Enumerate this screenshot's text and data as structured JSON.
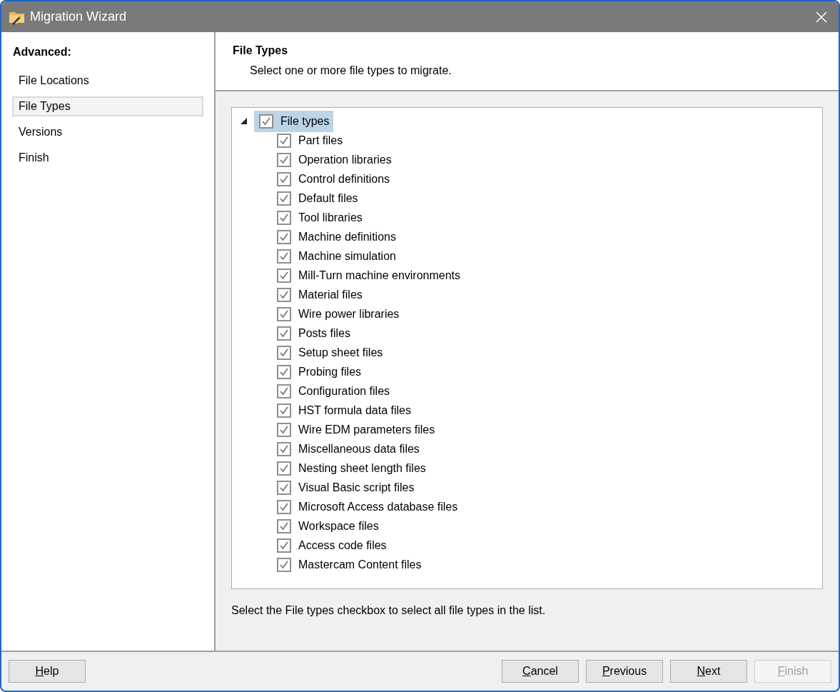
{
  "window": {
    "title": "Migration Wizard"
  },
  "sidebar": {
    "heading": "Advanced:",
    "items": [
      {
        "label": "File Locations",
        "selected": false
      },
      {
        "label": "File Types",
        "selected": true
      },
      {
        "label": "Versions",
        "selected": false
      },
      {
        "label": "Finish",
        "selected": false
      }
    ]
  },
  "header": {
    "title": "File Types",
    "subtitle": "Select one or more file types to migrate."
  },
  "tree": {
    "label": "File types",
    "checked": true,
    "expanded": true,
    "selected": true,
    "children": [
      {
        "label": "Part files",
        "checked": true
      },
      {
        "label": "Operation libraries",
        "checked": true
      },
      {
        "label": "Control definitions",
        "checked": true
      },
      {
        "label": "Default files",
        "checked": true
      },
      {
        "label": "Tool libraries",
        "checked": true
      },
      {
        "label": "Machine definitions",
        "checked": true
      },
      {
        "label": "Machine simulation",
        "checked": true
      },
      {
        "label": "Mill-Turn machine environments",
        "checked": true
      },
      {
        "label": "Material files",
        "checked": true
      },
      {
        "label": "Wire power libraries",
        "checked": true
      },
      {
        "label": "Posts files",
        "checked": true
      },
      {
        "label": "Setup sheet files",
        "checked": true
      },
      {
        "label": "Probing files",
        "checked": true
      },
      {
        "label": "Configuration files",
        "checked": true
      },
      {
        "label": "HST formula data files",
        "checked": true
      },
      {
        "label": "Wire EDM parameters files",
        "checked": true
      },
      {
        "label": "Miscellaneous data files",
        "checked": true
      },
      {
        "label": "Nesting sheet length files",
        "checked": true
      },
      {
        "label": "Visual Basic script files",
        "checked": true
      },
      {
        "label": "Microsoft Access database files",
        "checked": true
      },
      {
        "label": "Workspace files",
        "checked": true
      },
      {
        "label": "Access code files",
        "checked": true
      },
      {
        "label": "Mastercam Content files",
        "checked": true
      }
    ]
  },
  "hint": "Select the File types checkbox to select all file types in the list.",
  "buttons_left": [
    {
      "label": "Help",
      "disabled": false
    }
  ],
  "buttons_right": [
    {
      "label": "Cancel",
      "disabled": false
    },
    {
      "label": "Previous",
      "disabled": false
    },
    {
      "label": "Next",
      "disabled": false
    },
    {
      "label": "Finish",
      "disabled": true
    }
  ]
}
